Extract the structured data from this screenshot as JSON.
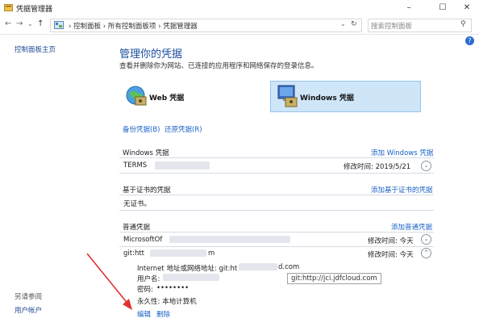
{
  "window": {
    "title": "凭据管理器",
    "min_glyph": "–",
    "max_glyph": "☐",
    "close_glyph": "✕",
    "chevron_glyph": "⌄"
  },
  "address": {
    "back": "←",
    "forward": "→",
    "dropdown": "⌄",
    "up": "↑",
    "crumbs": "›  控制面板  ›  所有控制面板项  ›  凭据管理器",
    "refresh": "↻",
    "search_placeholder": "搜索控制面板",
    "search_glyph": "⚲",
    "help_glyph": "?"
  },
  "sidebar": {
    "home": "控制面板主页",
    "see_also": "另请参阅",
    "user_accounts": "用户帐户"
  },
  "main": {
    "heading": "管理你的凭据",
    "description": "查看并删除你为网站、已连接的应用程序和网络保存的登录信息。",
    "web_cred": "Web 凭据",
    "windows_cred": "Windows 凭据",
    "backup": "备份凭据(B)",
    "restore": "还原凭据(R)"
  },
  "sections": {
    "windows": {
      "title": "Windows 凭据",
      "add": "添加 Windows 凭据",
      "item_name": "TERMS",
      "item_modified": "修改时间:  2019/5/21"
    },
    "cert": {
      "title": "基于证书的凭据",
      "add": "添加基于证书的凭据",
      "empty": "无证书。"
    },
    "generic": {
      "title": "普通凭据",
      "add": "添加普通凭据",
      "item1_name": "MicrosoftOf",
      "item1_modified": "修改时间:  今天",
      "item2_name": "git:htt",
      "item2_name_tail": "m",
      "item2_modified": "修改时间:  今天",
      "detail_address_label": "Internet 地址或网络地址:  git:ht",
      "detail_address_tail": "d.com",
      "detail_user_label": "用户名:",
      "detail_password_label": "密码:",
      "detail_password_value": "••••••••",
      "detail_persist": "永久性:  本地计算机",
      "tooltip": "git:http://jci.jdfcloud.com",
      "edit": "编辑",
      "delete": "删除"
    }
  },
  "colors": {
    "link": "#1a63c7",
    "heading": "#1a4f9e",
    "selected_card": "#cfe5f8",
    "annotation_arrow": "#e03030"
  }
}
